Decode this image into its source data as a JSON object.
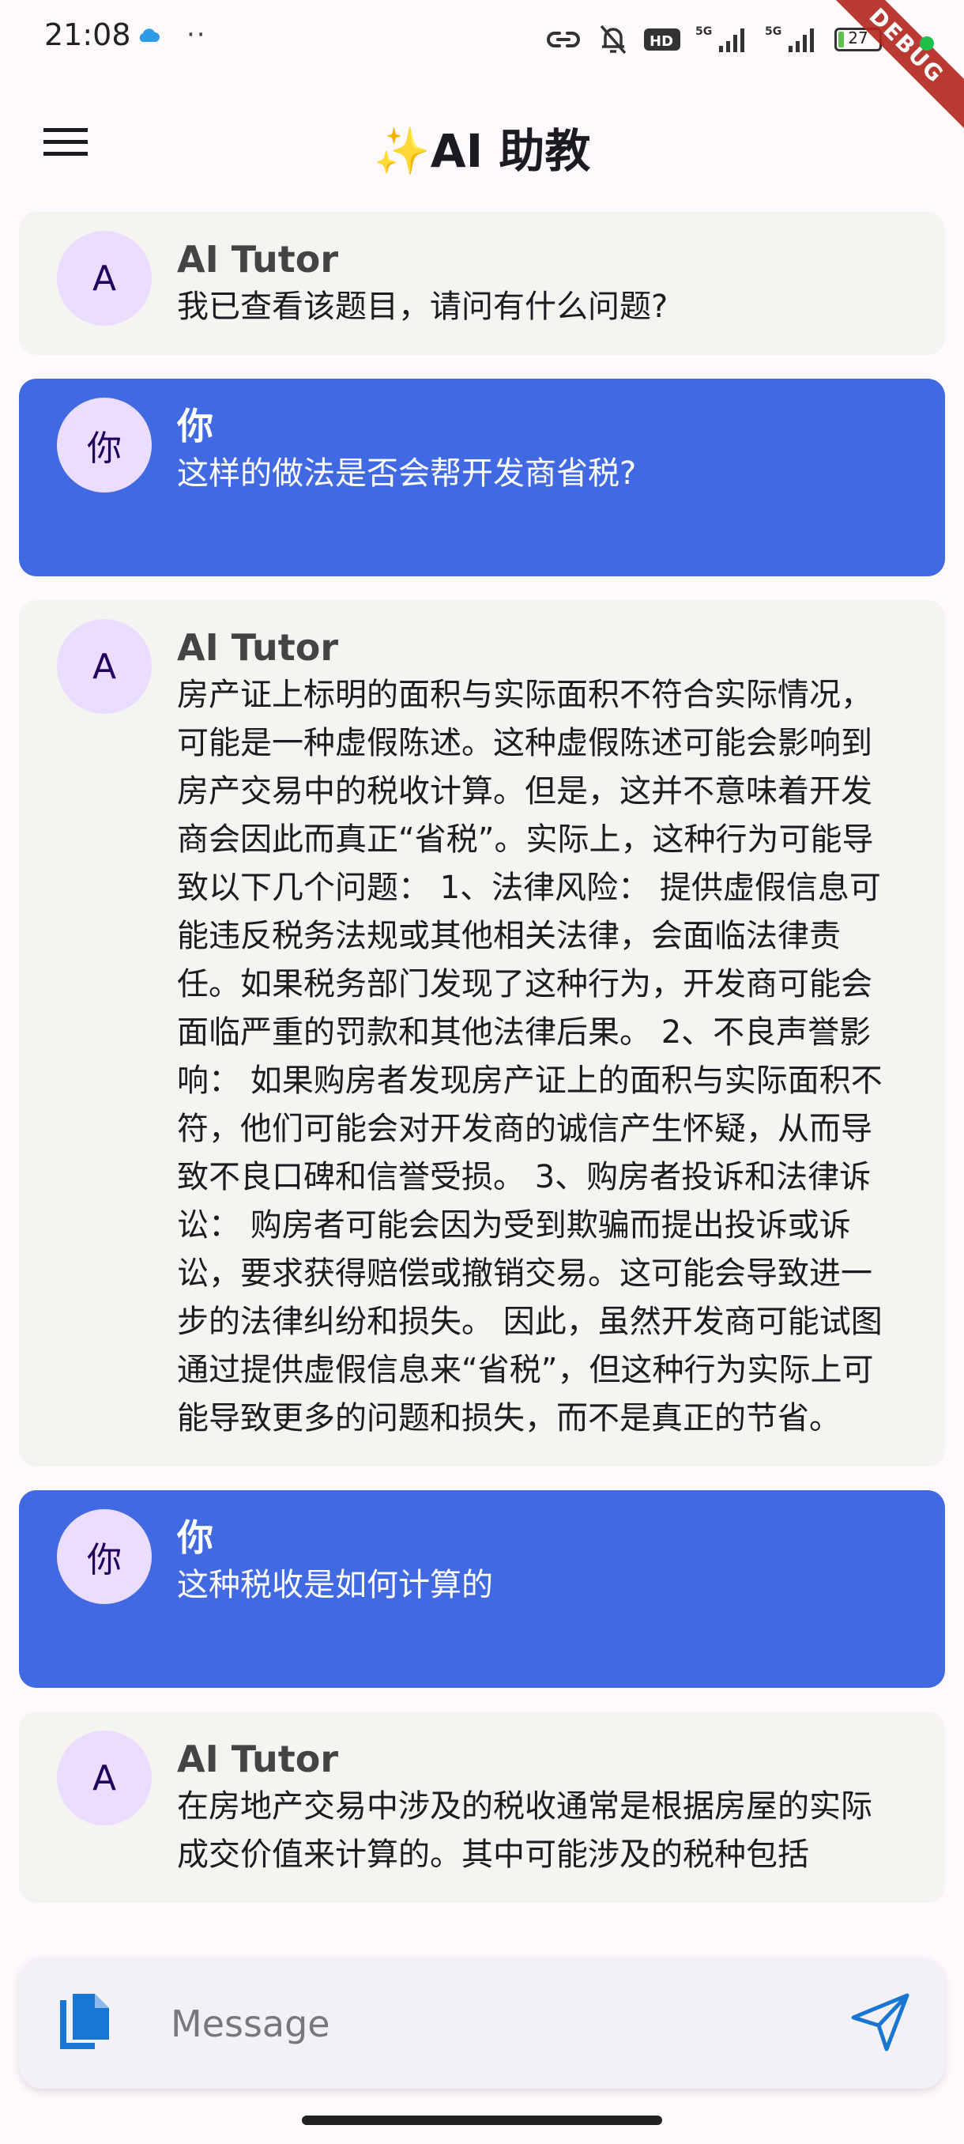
{
  "status_bar": {
    "time": "21:08",
    "dots": "··",
    "battery_level": "27",
    "network_1": "5G",
    "network_2": "5G",
    "hd_badge": "HD",
    "debug_label": "DEBUG",
    "icons": [
      "cloud-icon",
      "link-icon",
      "bell-off-icon",
      "hd-icon",
      "signal-icon",
      "signal-icon",
      "battery-icon"
    ]
  },
  "app_bar": {
    "title": "✨AI 助教",
    "menu_icon": "menu-icon"
  },
  "messages": [
    {
      "role": "ai",
      "avatar": "A",
      "sender": "AI Tutor",
      "text": "我已查看该题目，请问有什么问题?"
    },
    {
      "role": "user",
      "avatar": "你",
      "sender": "你",
      "text": "这样的做法是否会帮开发商省税?"
    },
    {
      "role": "ai",
      "avatar": "A",
      "sender": "AI Tutor",
      "text": "房产证上标明的面积与实际面积不符合实际情况，可能是一种虚假陈述。这种虚假陈述可能会影响到房产交易中的税收计算。但是，这并不意味着开发商会因此而真正“省税”。实际上，这种行为可能导致以下几个问题： 1、法律风险： 提供虚假信息可能违反税务法规或其他相关法律，会面临法律责任。如果税务部门发现了这种行为，开发商可能会面临严重的罚款和其他法律后果。 2、不良声誉影响： 如果购房者发现房产证上的面积与实际面积不符，他们可能会对开发商的诚信产生怀疑，从而导致不良口碑和信誉受损。 3、购房者投诉和法律诉讼： 购房者可能会因为受到欺骗而提出投诉或诉讼，要求获得赔偿或撤销交易。这可能会导致进一步的法律纠纷和损失。 因此，虽然开发商可能试图通过提供虚假信息来“省税”，但这种行为实际上可能导致更多的问题和损失，而不是真正的节省。"
    },
    {
      "role": "user",
      "avatar": "你",
      "sender": "你",
      "text": "这种税收是如何计算的"
    },
    {
      "role": "ai",
      "avatar": "A",
      "sender": "AI Tutor",
      "text": "在房地产交易中涉及的税收通常是根据房屋的实际成交价值来计算的。其中可能涉及的税种包括"
    }
  ],
  "composer": {
    "placeholder": "Message",
    "value": "",
    "attach_icon": "file-copy-icon",
    "send_icon": "send-icon"
  },
  "colors": {
    "user_bubble": "#4169e1",
    "ai_bubble": "#f4f4f1",
    "avatar_bg": "#eaddff",
    "accent": "#1976d2"
  }
}
